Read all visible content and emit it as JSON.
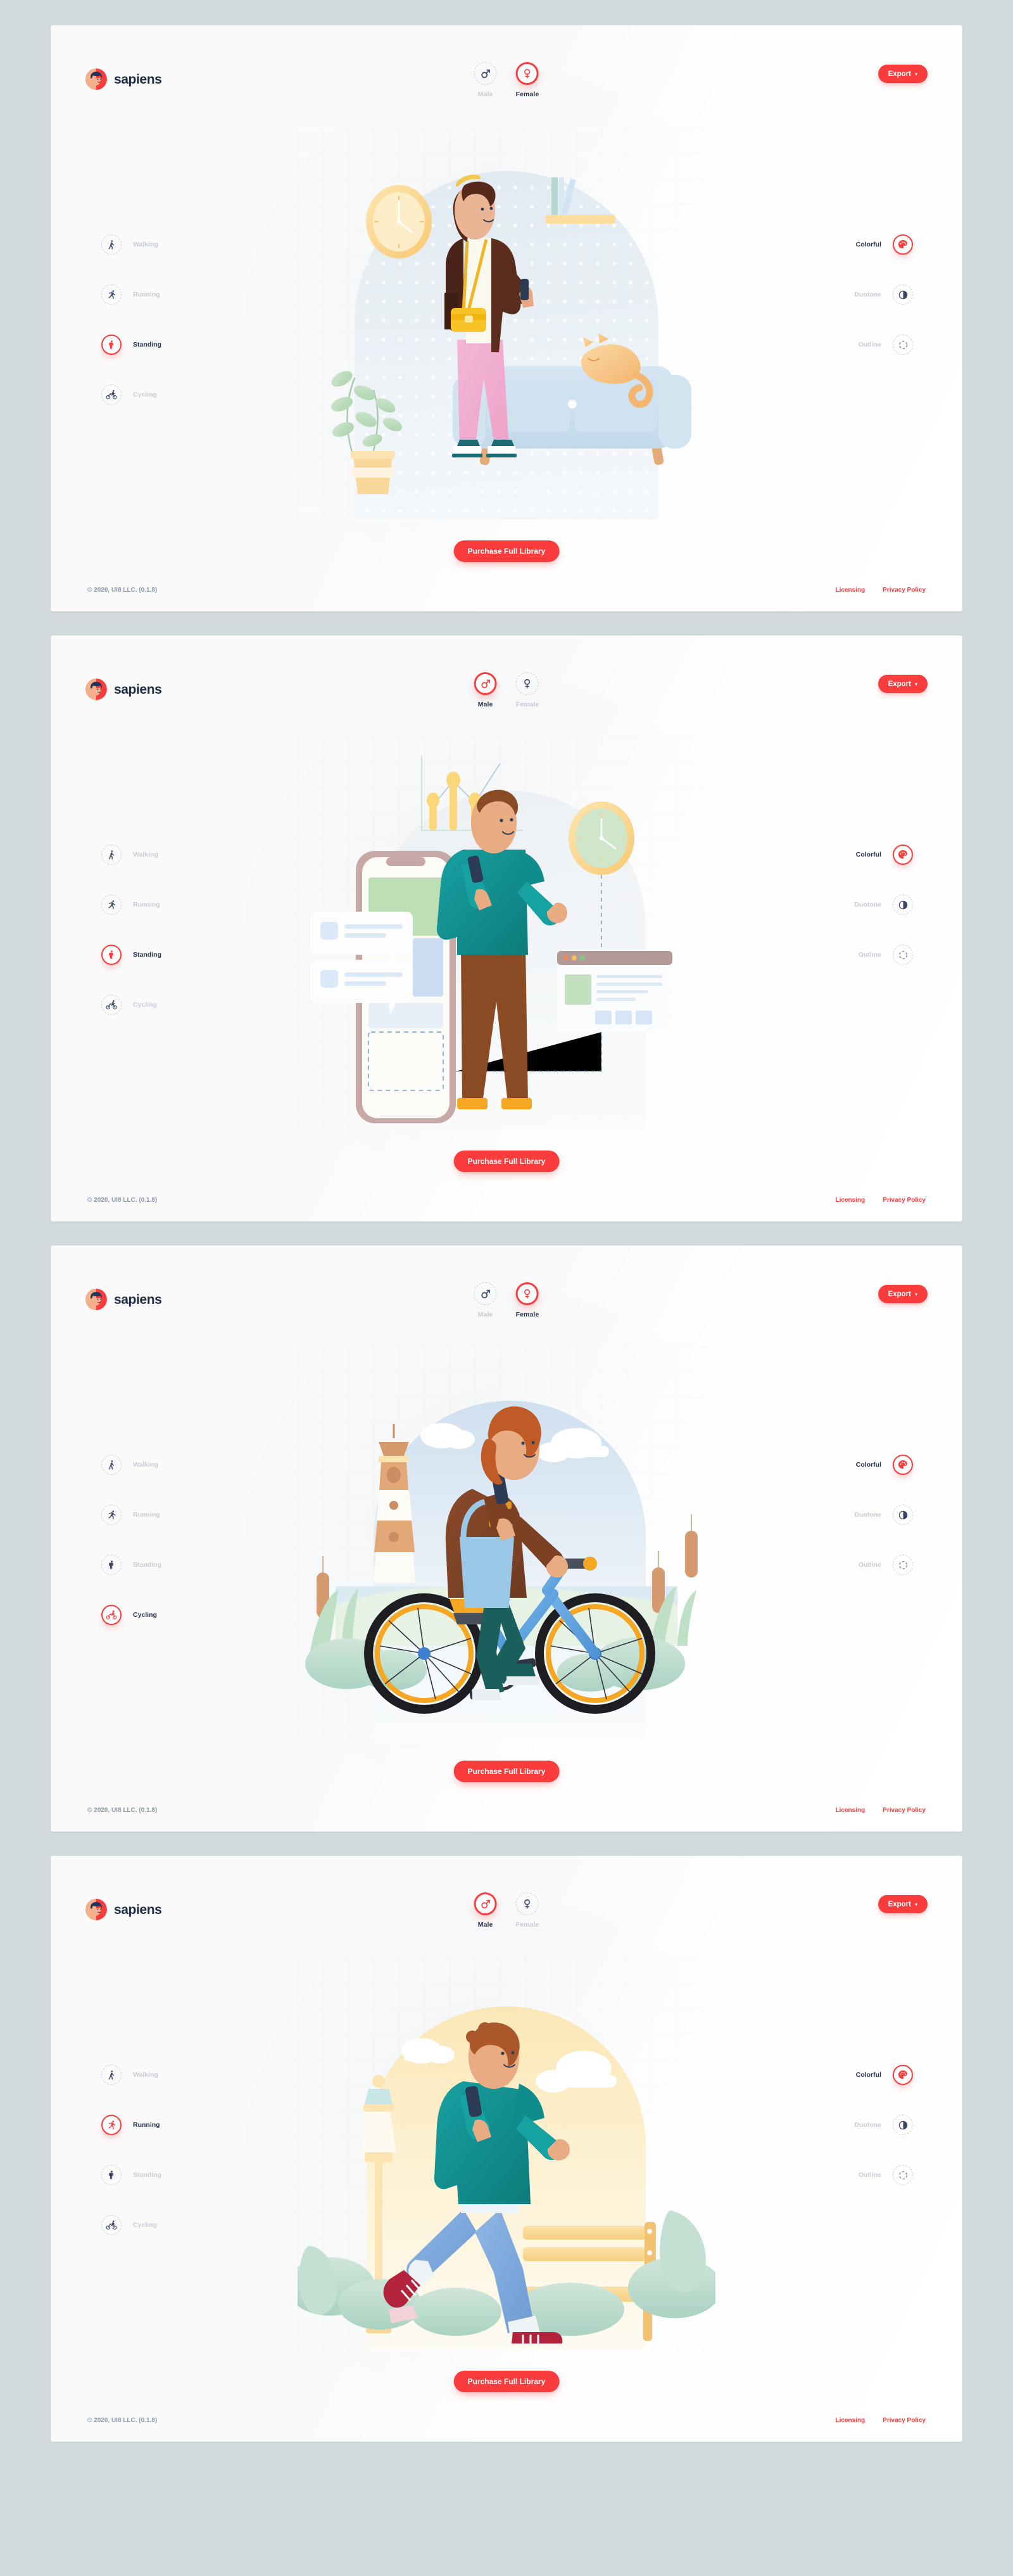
{
  "brand": {
    "name": "sapiens",
    "logo_icon": "avatar-face-icon",
    "accent": "#fa3c3c",
    "ink": "#27314d",
    "muted": "#c8ccd4",
    "page_bg": "#d2dadd",
    "card_bg": "#fafafa"
  },
  "header": {
    "export_label": "Export",
    "export_caret": "▾",
    "gender_options": [
      {
        "key": "male",
        "label": "Male",
        "icon": "mars-icon"
      },
      {
        "key": "female",
        "label": "Female",
        "icon": "venus-icon"
      }
    ]
  },
  "poses": [
    {
      "key": "walking",
      "label": "Walking",
      "icon": "walking-person-icon"
    },
    {
      "key": "running",
      "label": "Running",
      "icon": "running-person-icon"
    },
    {
      "key": "standing",
      "label": "Standing",
      "icon": "standing-person-icon"
    },
    {
      "key": "cycling",
      "label": "Cycling",
      "icon": "cycling-person-icon"
    }
  ],
  "styles": [
    {
      "key": "colorful",
      "label": "Colorful",
      "icon": "palette-icon"
    },
    {
      "key": "duotone",
      "label": "Duotone",
      "icon": "half-circle-icon"
    },
    {
      "key": "outline",
      "label": "Outline",
      "icon": "dashed-ring-icon"
    }
  ],
  "footer": {
    "cta_label": "Purchase Full Library",
    "copyright": "© 2020, UI8 LLC. (0.1.8)",
    "links": [
      {
        "label": "Licensing"
      },
      {
        "label": "Privacy Policy"
      }
    ]
  },
  "cards": [
    {
      "id": "card-standing-female",
      "gender": "female",
      "pose": "standing",
      "style": "colorful",
      "scene": "woman-standing-livingroom",
      "scene_items": [
        "wall-clock",
        "potted-plant",
        "bookshelf",
        "sofa",
        "sleeping-cat",
        "smartphone",
        "handbag"
      ]
    },
    {
      "id": "card-standing-male",
      "gender": "male",
      "pose": "standing",
      "style": "colorful",
      "scene": "man-standing-phone-ui",
      "scene_items": [
        "bar-chart",
        "wall-clock",
        "smartphone-mockup",
        "chat-bubbles",
        "browser-window"
      ]
    },
    {
      "id": "card-cycling-female",
      "gender": "female",
      "pose": "cycling",
      "style": "colorful",
      "scene": "woman-cycling-park",
      "scene_items": [
        "lighthouse",
        "clouds",
        "cattails",
        "bicycle",
        "tote-bag",
        "smartphone"
      ]
    },
    {
      "id": "card-running-male",
      "gender": "male",
      "pose": "running",
      "style": "colorful",
      "scene": "man-running-park",
      "scene_items": [
        "street-lamp",
        "clouds",
        "park-bench",
        "bushes",
        "smartphone"
      ]
    }
  ]
}
